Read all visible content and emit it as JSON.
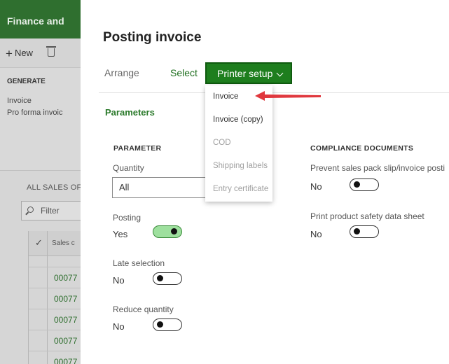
{
  "background": {
    "header_title": "Finance and",
    "toolbar": {
      "new_label": "New",
      "new_icon": "plus-icon",
      "delete_icon": "trash-icon"
    },
    "action_pane": {
      "group_title": "GENERATE",
      "links": [
        "Invoice",
        "Pro forma invoic"
      ]
    },
    "grid": {
      "title": "ALL SALES OF",
      "filter_placeholder": "Filter",
      "column_header": "Sales c",
      "rows": [
        "00077",
        "00077",
        "00077",
        "00077",
        "00077"
      ]
    }
  },
  "dialog": {
    "title": "Posting invoice",
    "toolbar": {
      "arrange_label": "Arrange",
      "select_label": "Select",
      "printer_setup_label": "Printer setup"
    },
    "printer_menu": {
      "items": [
        {
          "label": "Invoice",
          "enabled": true
        },
        {
          "label": "Invoice (copy)",
          "enabled": true
        },
        {
          "label": "COD",
          "enabled": false
        },
        {
          "label": "Shipping labels",
          "enabled": false
        },
        {
          "label": "Entry certificate",
          "enabled": false
        }
      ]
    },
    "parameters": {
      "section_title": "Parameters",
      "parameter_group": {
        "heading": "PARAMETER",
        "quantity_label": "Quantity",
        "quantity_value": "All",
        "posting_label": "Posting",
        "posting_value": "Yes",
        "late_selection_label": "Late selection",
        "late_selection_value": "No",
        "reduce_quantity_label": "Reduce quantity",
        "reduce_quantity_value": "No"
      },
      "compliance_group": {
        "heading": "COMPLIANCE DOCUMENTS",
        "prevent_label": "Prevent sales pack slip/invoice posti",
        "prevent_value": "No",
        "safety_label": "Print product safety data sheet",
        "safety_value": "No"
      }
    }
  },
  "colors": {
    "brand_green": "#1e7e1e",
    "toggle_on": "#9ee09e",
    "annotation_arrow": "#e0383e"
  }
}
